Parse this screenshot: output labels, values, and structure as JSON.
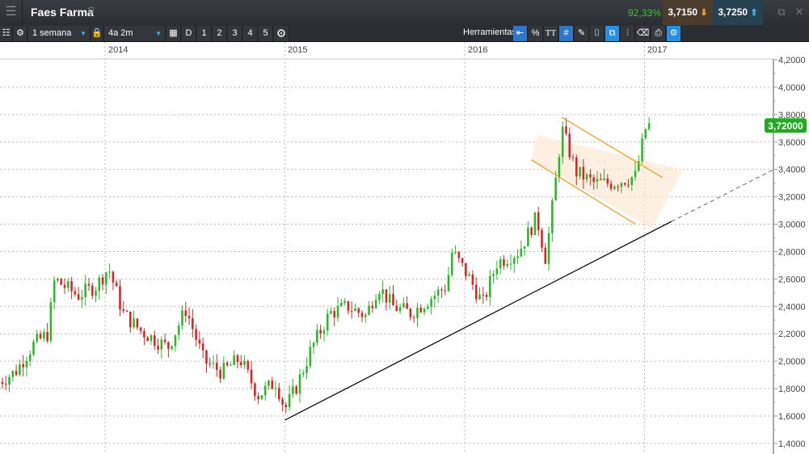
{
  "header": {
    "title": "Faes Farma",
    "change_pct": "92,33%",
    "sell_price": "3,7150",
    "buy_price": "3,7250"
  },
  "toolbar": {
    "interval": "1 semana",
    "range": "4a 2m",
    "period_buttons": [
      "D",
      "1",
      "2",
      "3",
      "4",
      "5"
    ],
    "tools_label": "Herramientas",
    "percent": "%",
    "text_tool": "TT"
  },
  "chart_data": {
    "type": "candlestick",
    "title": "Faes Farma",
    "x_labels": [
      "2014",
      "2015",
      "2016",
      "2017"
    ],
    "y_ticks": [
      "4,2000",
      "4,0000",
      "3,8000",
      "3,6000",
      "3,4000",
      "3,2000",
      "3,0000",
      "2,8000",
      "2,6000",
      "2,4000",
      "2,2000",
      "2,0000",
      "1,8000",
      "1,6000",
      "1,4000"
    ],
    "ylim": [
      1.4,
      4.2
    ],
    "last_price_label": "3,72000",
    "last_price": 3.72,
    "price_path": [
      [
        2013.41,
        1.85
      ],
      [
        2013.5,
        1.92
      ],
      [
        2013.6,
        2.12
      ],
      [
        2013.68,
        2.2
      ],
      [
        2013.72,
        2.6
      ],
      [
        2013.77,
        2.55
      ],
      [
        2013.85,
        2.48
      ],
      [
        2013.95,
        2.55
      ],
      [
        2014.02,
        2.68
      ],
      [
        2014.1,
        2.35
      ],
      [
        2014.2,
        2.22
      ],
      [
        2014.35,
        2.1
      ],
      [
        2014.45,
        2.38
      ],
      [
        2014.55,
        2.0
      ],
      [
        2014.65,
        1.92
      ],
      [
        2014.75,
        2.02
      ],
      [
        2014.85,
        1.75
      ],
      [
        2014.95,
        1.85
      ],
      [
        2015.0,
        1.65
      ],
      [
        2015.06,
        1.8
      ],
      [
        2015.15,
        2.1
      ],
      [
        2015.25,
        2.35
      ],
      [
        2015.35,
        2.4
      ],
      [
        2015.45,
        2.33
      ],
      [
        2015.52,
        2.55
      ],
      [
        2015.6,
        2.4
      ],
      [
        2015.7,
        2.35
      ],
      [
        2015.8,
        2.45
      ],
      [
        2015.9,
        2.55
      ],
      [
        2015.93,
        2.8
      ],
      [
        2016.02,
        2.62
      ],
      [
        2016.1,
        2.42
      ],
      [
        2016.18,
        2.72
      ],
      [
        2016.3,
        2.8
      ],
      [
        2016.4,
        3.05
      ],
      [
        2016.45,
        2.75
      ],
      [
        2016.5,
        3.25
      ],
      [
        2016.54,
        3.7
      ],
      [
        2016.62,
        3.38
      ],
      [
        2016.72,
        3.3
      ],
      [
        2016.82,
        3.3
      ],
      [
        2016.95,
        3.35
      ],
      [
        2017.01,
        3.72
      ]
    ],
    "trendline": {
      "from": [
        2015.0,
        1.57
      ],
      "to": [
        2017.15,
        3.02
      ],
      "extend_to": [
        2017.72,
        3.4
      ]
    },
    "channel": {
      "upper": [
        [
          2016.54,
          3.78
        ],
        [
          2017.1,
          3.34
        ]
      ],
      "lower": [
        [
          2016.37,
          3.47
        ],
        [
          2016.95,
          3.0
        ]
      ]
    },
    "colors": {
      "up": "#2db82d",
      "down": "#d62828",
      "channel": "#f0a020",
      "label": "#22aa22"
    }
  }
}
